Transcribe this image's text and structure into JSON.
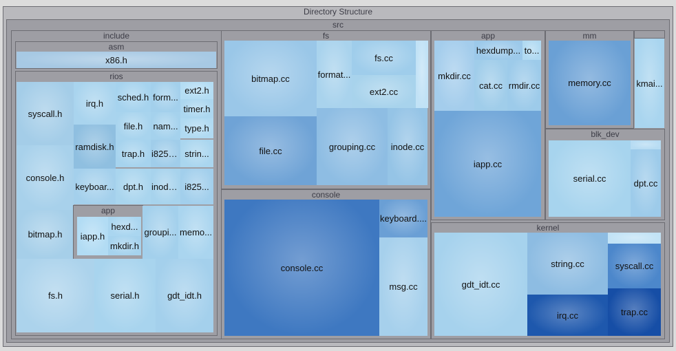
{
  "chart_data": {
    "type": "treemap",
    "title": "Directory Structure",
    "root": {
      "name": "src",
      "children": [
        {
          "name": "include",
          "children": [
            {
              "name": "asm",
              "children": [
                {
                  "name": "x86.h"
                }
              ]
            },
            {
              "name": "rios",
              "children": [
                {
                  "name": "syscall.h"
                },
                {
                  "name": "irq.h"
                },
                {
                  "name": "sched.h"
                },
                {
                  "name": "form..."
                },
                {
                  "name": "ext2.h"
                },
                {
                  "name": "timer.h"
                },
                {
                  "name": "file.h"
                },
                {
                  "name": "nam..."
                },
                {
                  "name": "type.h"
                },
                {
                  "name": "ramdisk.h"
                },
                {
                  "name": "trap.h"
                },
                {
                  "name": "i8253.h"
                },
                {
                  "name": "strin..."
                },
                {
                  "name": "console.h"
                },
                {
                  "name": "keyboar..."
                },
                {
                  "name": "dpt.h"
                },
                {
                  "name": "inode.h"
                },
                {
                  "name": "i825..."
                },
                {
                  "name": "bitmap.h"
                },
                {
                  "name": "app",
                  "children": [
                    {
                      "name": "iapp.h"
                    },
                    {
                      "name": "hexd..."
                    },
                    {
                      "name": "mkdir.h"
                    }
                  ]
                },
                {
                  "name": "groupi..."
                },
                {
                  "name": "memo..."
                },
                {
                  "name": "fs.h"
                },
                {
                  "name": "serial.h"
                },
                {
                  "name": "gdt_idt.h"
                }
              ]
            }
          ]
        },
        {
          "name": "fs",
          "children": [
            {
              "name": "bitmap.cc"
            },
            {
              "name": "format..."
            },
            {
              "name": "fs.cc"
            },
            {
              "name": "ext2.cc"
            },
            {
              "name": ""
            },
            {
              "name": "file.cc"
            },
            {
              "name": "grouping.cc"
            },
            {
              "name": "inode.cc"
            }
          ]
        },
        {
          "name": "console",
          "children": [
            {
              "name": "console.cc"
            },
            {
              "name": "keyboard...."
            },
            {
              "name": "msg.cc"
            }
          ]
        },
        {
          "name": "app",
          "children": [
            {
              "name": "mkdir.cc"
            },
            {
              "name": "hexdump..."
            },
            {
              "name": "to..."
            },
            {
              "name": "cat.cc"
            },
            {
              "name": "rmdir.cc"
            },
            {
              "name": "iapp.cc"
            }
          ]
        },
        {
          "name": "mm",
          "children": [
            {
              "name": "memory.cc"
            }
          ]
        },
        {
          "name": "",
          "children": []
        },
        {
          "name": "kmai..."
        },
        {
          "name": "blk_dev",
          "children": [
            {
              "name": ""
            },
            {
              "name": "serial.cc"
            },
            {
              "name": "dpt.cc"
            }
          ]
        },
        {
          "name": "kernel",
          "children": [
            {
              "name": "gdt_idt.cc"
            },
            {
              "name": "string.cc"
            },
            {
              "name": ""
            },
            {
              "name": "syscall.cc"
            },
            {
              "name": "irq.cc"
            },
            {
              "name": "trap.cc"
            }
          ]
        }
      ]
    }
  }
}
